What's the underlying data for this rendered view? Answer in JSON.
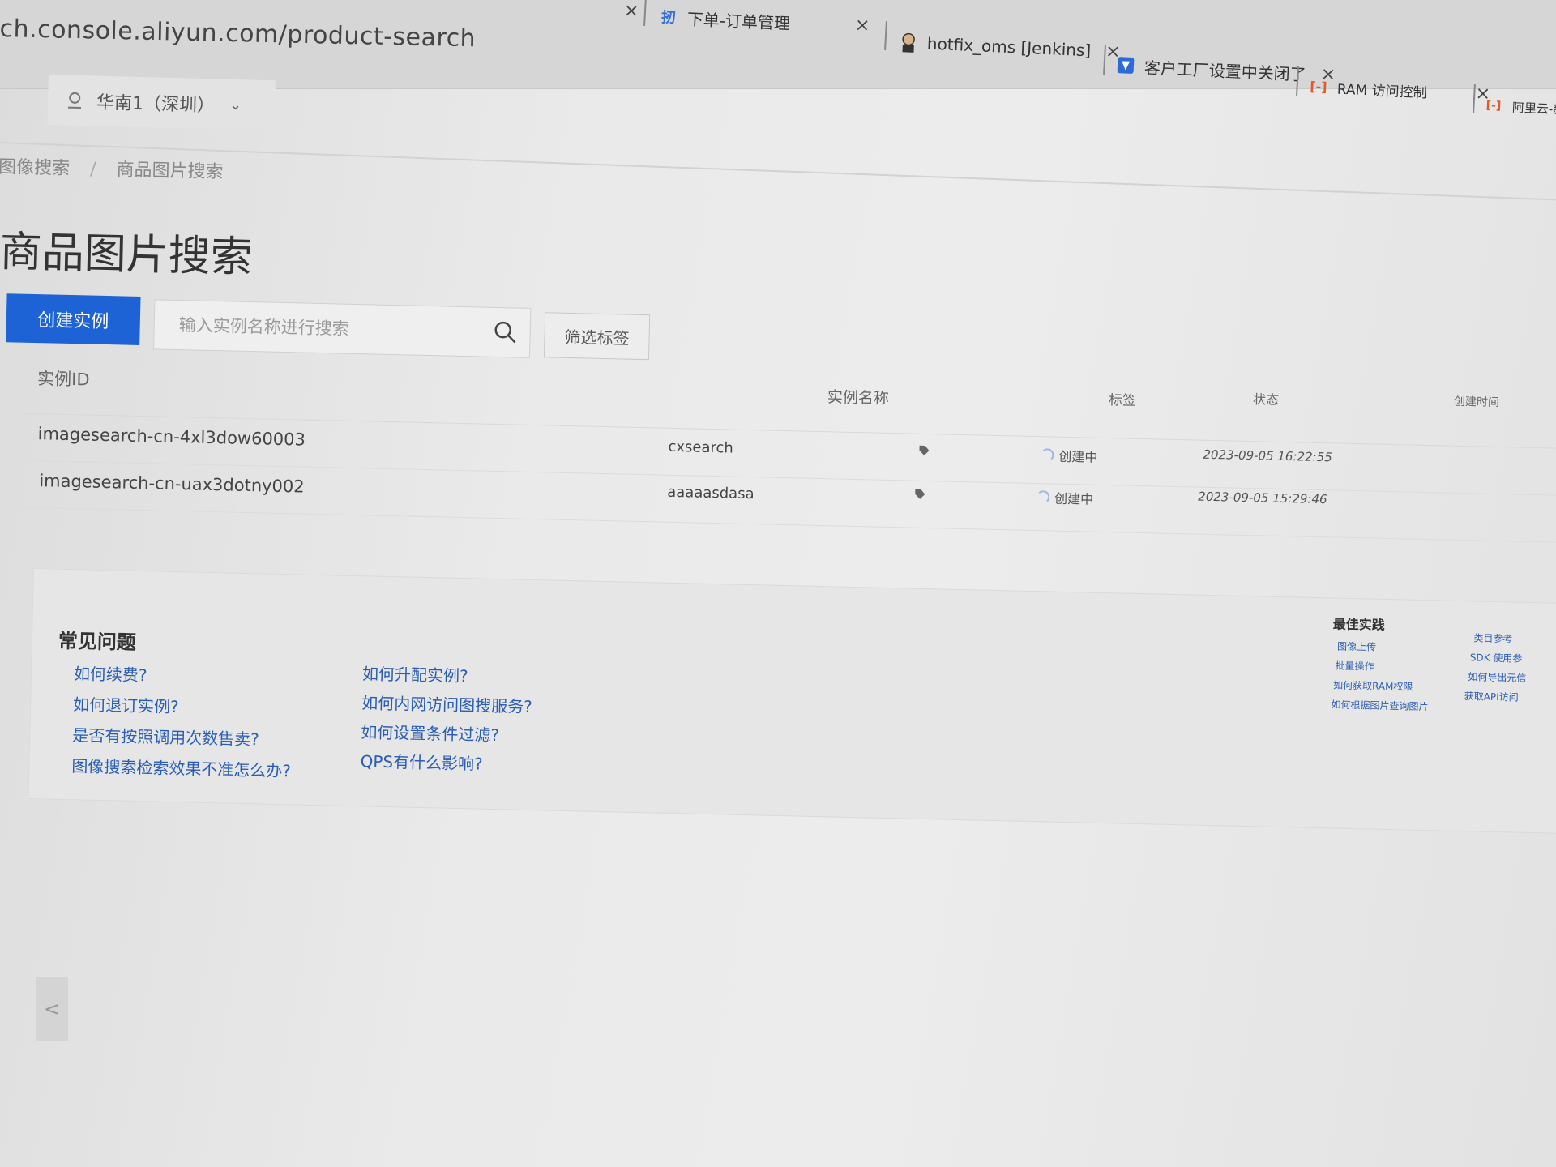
{
  "browser": {
    "url": "ch.console.aliyun.com/product-search",
    "tabs": [
      {
        "label": "下单-订单管理",
        "icon": "order-tab-icon"
      },
      {
        "label": "hotfix_oms [Jenkins]",
        "icon": "jenkins-icon"
      },
      {
        "label": "客户工厂设置中关闭了",
        "icon": "jira-icon"
      },
      {
        "label": "RAM 访问控制",
        "icon": "aliyun-icon"
      },
      {
        "label": "阿里云-新",
        "icon": "aliyun-icon"
      }
    ],
    "close_glyph": "×"
  },
  "region": {
    "label": "华南1（深圳）",
    "chevron": "⌄"
  },
  "breadcrumb": {
    "items": [
      "图像搜索",
      "商品图片搜索"
    ],
    "separator": "/"
  },
  "page": {
    "title": "商品图片搜索"
  },
  "toolbar": {
    "create_label": "创建实例",
    "search_placeholder": "输入实例名称进行搜索",
    "filter_label": "筛选标签"
  },
  "table": {
    "headers": {
      "id": "实例ID",
      "name": "实例名称",
      "tag": "标签",
      "status": "状态",
      "created": "创建时间"
    },
    "rows": [
      {
        "id": "imagesearch-cn-4xl3dow60003",
        "name": "cxsearch",
        "status": "创建中",
        "created": "2023-09-05 16:22:55"
      },
      {
        "id": "imagesearch-cn-uax3dotny002",
        "name": "aaaaasdasa",
        "status": "创建中",
        "created": "2023-09-05 15:29:46"
      }
    ]
  },
  "faq": {
    "title": "常见问题",
    "col1": [
      "如何续费?",
      "如何退订实例?",
      "是否有按照调用次数售卖?",
      "图像搜索检索效果不准怎么办?"
    ],
    "col2": [
      "如何升配实例?",
      "如何内网访问图搜服务?",
      "如何设置条件过滤?",
      "QPS有什么影响?"
    ]
  },
  "best_practice": {
    "title": "最佳实践",
    "col1": [
      "图像上传",
      "批量操作",
      "如何获取RAM权限",
      "如何根据图片查询图片"
    ],
    "col2": [
      "类目参考",
      "SDK 使用参",
      "如何导出元信",
      "获取API访问"
    ]
  },
  "sidebar": {
    "collapse_glyph": "<"
  },
  "colors": {
    "primary": "#1e63d6",
    "link": "#2a5db5"
  }
}
